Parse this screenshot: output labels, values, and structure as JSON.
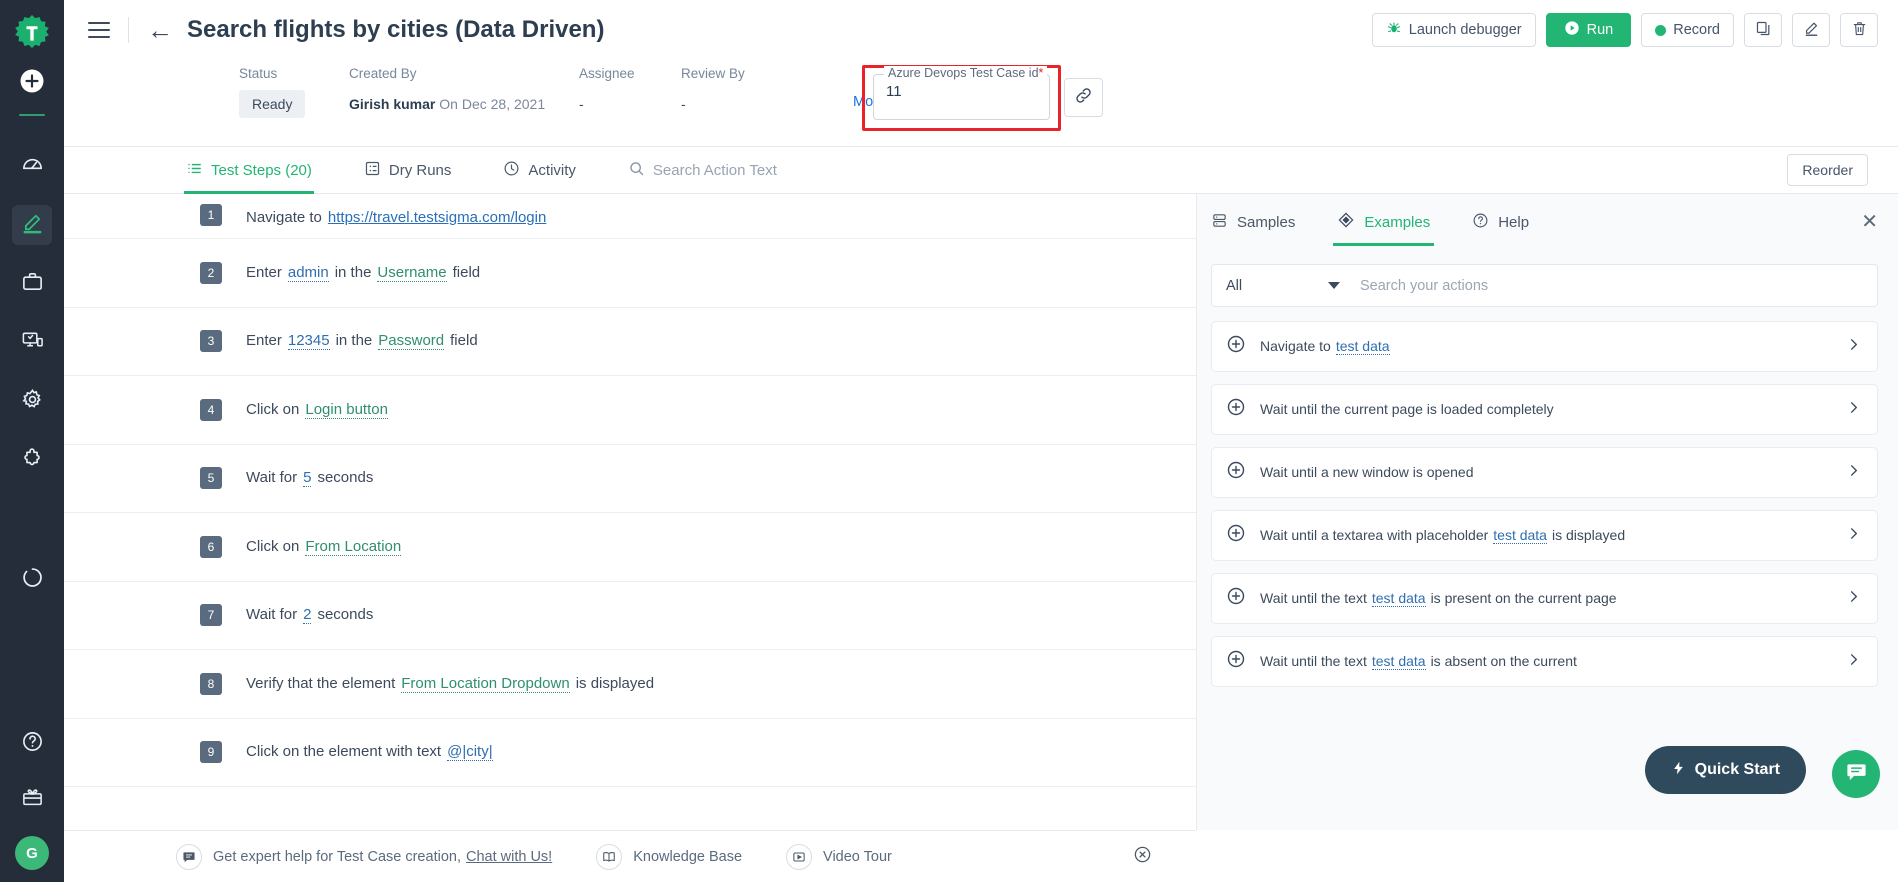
{
  "rail": {
    "logo_icon": "testsigma-logo-icon",
    "add_icon": "plus-circle-icon",
    "items": [
      {
        "name": "dashboard",
        "icon": "speedometer-icon",
        "active": false
      },
      {
        "name": "test-development",
        "icon": "pencil-icon",
        "active": true
      },
      {
        "name": "test-plans",
        "icon": "briefcase-icon",
        "active": false
      },
      {
        "name": "test-lab",
        "icon": "devices-icon",
        "active": false
      },
      {
        "name": "settings",
        "icon": "gear-icon",
        "active": false
      },
      {
        "name": "addons",
        "icon": "puzzle-icon",
        "active": false
      },
      {
        "name": "runs",
        "icon": "circle-progress-icon",
        "active": false
      }
    ],
    "bottom": [
      {
        "name": "help",
        "icon": "question-circle-icon"
      },
      {
        "name": "whats-new",
        "icon": "gift-icon"
      }
    ],
    "avatar_initial": "G"
  },
  "header": {
    "menu_icon": "hamburger-icon",
    "back_icon": "arrow-left-icon",
    "title": "Search flights by cities (Data Driven)",
    "buttons": {
      "launch_debugger": "Launch debugger",
      "launch_debugger_icon": "bug-icon",
      "run": "Run",
      "run_icon": "play-circle-icon",
      "record": "Record",
      "record_icon": "record-dot-icon",
      "copy_icon": "copy-icon",
      "edit_icon": "pencil-edit-icon",
      "delete_icon": "trash-icon"
    }
  },
  "meta": {
    "status_label": "Status",
    "status_value": "Ready",
    "created_by_label": "Created By",
    "created_by_name": "Girish kumar",
    "created_by_date": "On Dec 28, 2021",
    "assignee_label": "Assignee",
    "assignee_value": "-",
    "review_by_label": "Review By",
    "review_by_value": "-",
    "more_details": "More details...",
    "azure_legend": "Azure Devops Test Case id",
    "azure_required_mark": "*",
    "azure_value": "11",
    "link_icon": "link-chain-icon"
  },
  "tabs": {
    "items": [
      {
        "label": "Test Steps (20)",
        "icon": "list-icon",
        "active": true
      },
      {
        "label": "Dry Runs",
        "icon": "grid-square-icon",
        "active": false
      },
      {
        "label": "Activity",
        "icon": "clock-icon",
        "active": false
      }
    ],
    "search_placeholder": "Search Action Text",
    "search_icon": "search-icon",
    "reorder_label": "Reorder"
  },
  "steps": [
    {
      "num": "1",
      "parts": [
        {
          "t": "Navigate to",
          "k": "plain"
        },
        {
          "t": "https://travel.testsigma.com/login",
          "k": "url"
        }
      ]
    },
    {
      "num": "2",
      "parts": [
        {
          "t": "Enter",
          "k": "plain"
        },
        {
          "t": "admin",
          "k": "data"
        },
        {
          "t": "in the",
          "k": "plain"
        },
        {
          "t": "Username",
          "k": "elem"
        },
        {
          "t": "field",
          "k": "plain"
        }
      ]
    },
    {
      "num": "3",
      "parts": [
        {
          "t": "Enter",
          "k": "plain"
        },
        {
          "t": "12345",
          "k": "data"
        },
        {
          "t": "in the",
          "k": "plain"
        },
        {
          "t": "Password",
          "k": "elem"
        },
        {
          "t": "field",
          "k": "plain"
        }
      ]
    },
    {
      "num": "4",
      "parts": [
        {
          "t": "Click on",
          "k": "plain"
        },
        {
          "t": "Login button",
          "k": "elem"
        }
      ]
    },
    {
      "num": "5",
      "parts": [
        {
          "t": "Wait for",
          "k": "plain"
        },
        {
          "t": "5",
          "k": "data"
        },
        {
          "t": "seconds",
          "k": "plain"
        }
      ]
    },
    {
      "num": "6",
      "parts": [
        {
          "t": "Click on",
          "k": "plain"
        },
        {
          "t": "From Location",
          "k": "elem"
        }
      ]
    },
    {
      "num": "7",
      "parts": [
        {
          "t": "Wait for",
          "k": "plain"
        },
        {
          "t": "2",
          "k": "data"
        },
        {
          "t": "seconds",
          "k": "plain"
        }
      ]
    },
    {
      "num": "8",
      "parts": [
        {
          "t": "Verify that the element",
          "k": "plain"
        },
        {
          "t": "From Location Dropdown",
          "k": "elem"
        },
        {
          "t": "is displayed",
          "k": "plain"
        }
      ]
    },
    {
      "num": "9",
      "parts": [
        {
          "t": "Click on the element with text",
          "k": "plain"
        },
        {
          "t": "@|city|",
          "k": "data"
        }
      ]
    }
  ],
  "side_panel": {
    "tabs": [
      {
        "label": "Samples",
        "icon": "database-icon",
        "active": false
      },
      {
        "label": "Examples",
        "icon": "diamond-icon",
        "active": true
      },
      {
        "label": "Help",
        "icon": "question-circle-icon",
        "active": false
      }
    ],
    "close_icon": "close-icon",
    "filter_value": "All",
    "filter_caret_icon": "chevron-down-icon",
    "search_placeholder": "Search your actions",
    "examples": [
      {
        "parts": [
          {
            "t": "Navigate to",
            "k": "plain"
          },
          {
            "t": "test data",
            "k": "data"
          }
        ]
      },
      {
        "parts": [
          {
            "t": "Wait until the current page is loaded completely",
            "k": "plain"
          }
        ]
      },
      {
        "parts": [
          {
            "t": "Wait until a new window is opened",
            "k": "plain"
          }
        ]
      },
      {
        "parts": [
          {
            "t": "Wait until a textarea with placeholder",
            "k": "plain"
          },
          {
            "t": "test data",
            "k": "data"
          },
          {
            "t": "is displayed",
            "k": "plain"
          }
        ]
      },
      {
        "parts": [
          {
            "t": "Wait until the text",
            "k": "plain"
          },
          {
            "t": "test data",
            "k": "data"
          },
          {
            "t": "is present on the current page",
            "k": "plain"
          }
        ]
      },
      {
        "parts": [
          {
            "t": "Wait until the text",
            "k": "plain"
          },
          {
            "t": "test data",
            "k": "data"
          },
          {
            "t": "is absent on the current",
            "k": "plain"
          }
        ]
      }
    ],
    "add_icon": "plus-circle-icon",
    "chevron_icon": "chevron-right-icon"
  },
  "bottom_bar": {
    "expert_text": "Get expert help for Test Case creation,",
    "chat_link": "Chat with Us!",
    "chat_icon": "chat-bubble-icon",
    "knowledge_base": "Knowledge Base",
    "knowledge_icon": "book-icon",
    "video_tour": "Video Tour",
    "video_icon": "video-play-icon",
    "close_icon": "close-circle-icon"
  },
  "floating": {
    "quick_start": "Quick Start",
    "quick_start_icon": "lightning-bolt-icon",
    "chat_fab_icon": "chat-icon"
  },
  "colors": {
    "brand_green": "#22b573",
    "rail_bg": "#252d3a",
    "accent_red": "#e8232a",
    "link_blue": "#1a73e8",
    "element_green": "#2f8f6e",
    "data_blue": "#2f6fb0"
  }
}
